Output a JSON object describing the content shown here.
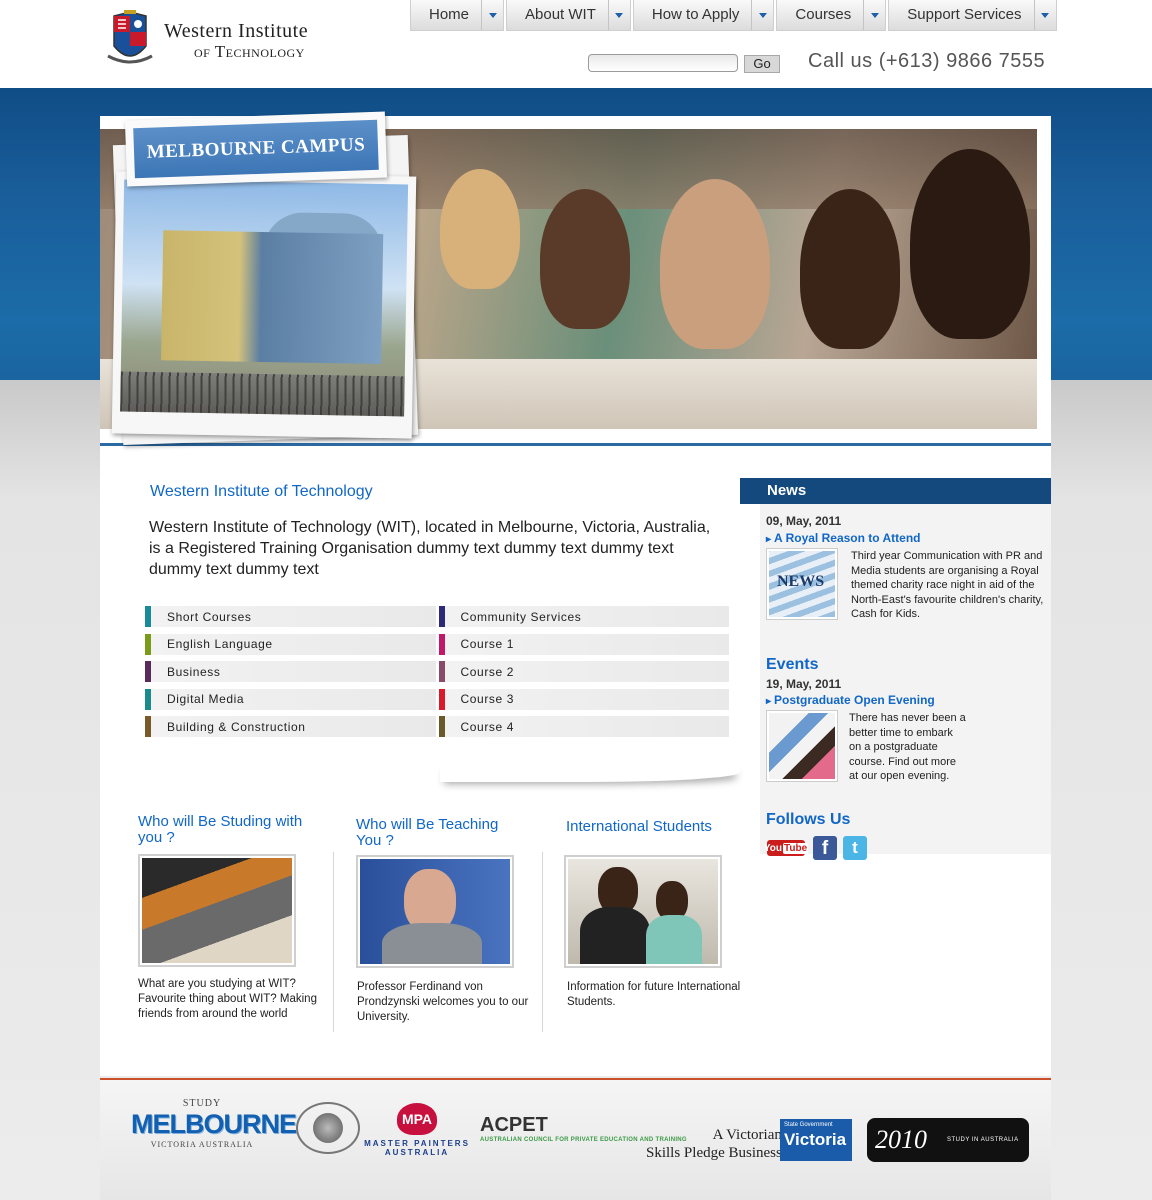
{
  "brand": {
    "line1": "Western Institute",
    "line2": "of Technology"
  },
  "nav": [
    {
      "label": "Home"
    },
    {
      "label": "About WIT"
    },
    {
      "label": "How to Apply"
    },
    {
      "label": "Courses"
    },
    {
      "label": "Support Services"
    }
  ],
  "search": {
    "value": "",
    "go_label": "Go"
  },
  "callus": "Call us (+613) 9866 7555",
  "hero": {
    "campus_label": "MELBOURNE CAMPUS"
  },
  "intro": {
    "title": "Western Institute of Technology",
    "text": "Western Institute of Technology (WIT), located in Melbourne, Victoria, Australia, is a Registered Training Organisation dummy text  dummy text dummy text dummy text dummy text"
  },
  "courses": [
    {
      "label": "Short Courses",
      "color": "#1a8a9a"
    },
    {
      "label": "Community Services",
      "color": "#2e2a7a"
    },
    {
      "label": "English Language",
      "color": "#7a9a1a"
    },
    {
      "label": "Course 1",
      "color": "#c0186a"
    },
    {
      "label": "Business",
      "color": "#5a2a5a"
    },
    {
      "label": "Course 2",
      "color": "#8a4a6a"
    },
    {
      "label": "Digital Media",
      "color": "#1a8a8a"
    },
    {
      "label": "Course 3",
      "color": "#d81a2a"
    },
    {
      "label": "Building & Construction",
      "color": "#7a5a2a"
    },
    {
      "label": "Course 4",
      "color": "#6a5a2a"
    }
  ],
  "sidebar": {
    "news_title": "News",
    "news": {
      "date": "09, May, 2011",
      "headline": "A Royal Reason to Attend",
      "text": "Third year Communication with PR and Media students are organising a Royal themed charity race night in aid of the North-East's favourite children's charity, Cash for Kids."
    },
    "events_title": "Events",
    "event": {
      "date": "19, May, 2011",
      "headline": "Postgraduate Open Evening",
      "text": "There has never been a better time to embark on a postgraduate course. Find out more at our open evening."
    },
    "follow_title": "Follows Us",
    "social": {
      "youtube": "You Tube",
      "facebook": "f",
      "twitter": "t"
    }
  },
  "blocks": [
    {
      "title": "Who will Be Studing with you ?",
      "text": "What are you studying at WIT? Favourite thing about WIT? Making friends from around the world"
    },
    {
      "title": "Who will Be Teaching You ?",
      "text": "Professor Ferdinand von Prondzynski welcomes you to our University."
    },
    {
      "title": "International Students",
      "text": "Information for future International Students."
    }
  ],
  "footer": {
    "study_top": "STUDY",
    "study_main": "MELBOURNE",
    "study_sub": "VICTORIA AUSTRALIA",
    "mpa_badge": "MPA",
    "mpa_text": "MASTER PAINTERS AUSTRALIA",
    "acpet": "ACPET",
    "acpet_sub": "AUSTRALIAN COUNCIL FOR PRIVATE EDUCATION AND TRAINING",
    "skills_line1": "A Victorian",
    "skills_line2": "Skills Pledge Business",
    "vic_small": "State Government",
    "vic_main": "Victoria",
    "year": "2010",
    "study_aus": "STUDY IN AUSTRALIA"
  }
}
